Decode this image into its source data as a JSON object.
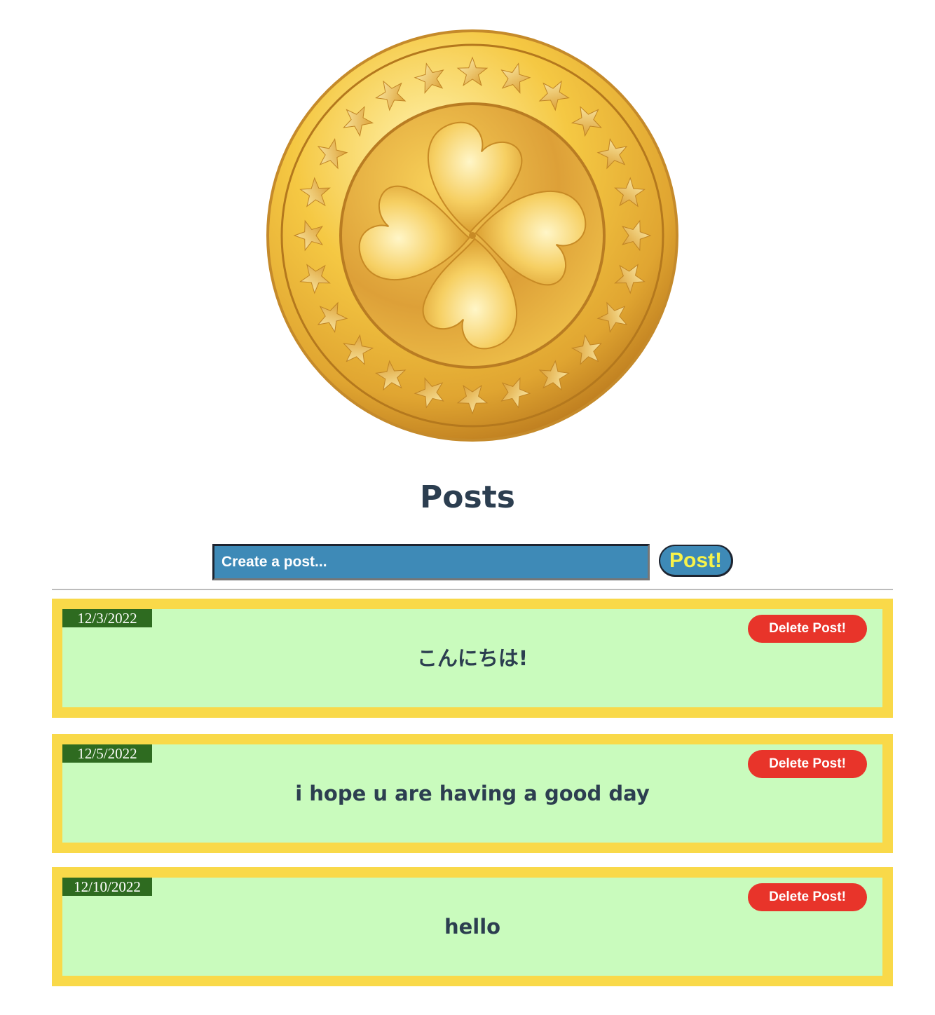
{
  "header": {
    "logo_icon": "gold-clover-coin-icon",
    "title": "Posts"
  },
  "composer": {
    "placeholder": "Create a post...",
    "value": "",
    "post_label": "Post!"
  },
  "posts": [
    {
      "date": "12/3/2022",
      "text": "こんにちは!",
      "delete_label": "Delete Post!"
    },
    {
      "date": "12/5/2022",
      "text": "i hope u are having a good day",
      "delete_label": "Delete Post!"
    },
    {
      "date": "12/10/2022",
      "text": "hello",
      "delete_label": "Delete Post!"
    }
  ],
  "colors": {
    "card_border": "#f9d949",
    "card_background": "#c9fbbd",
    "date_badge": "#2e6b20",
    "delete_button": "#e8342a",
    "input_background": "#3e8ab7",
    "post_button_text": "#f7f24a",
    "text": "#2c3e50"
  }
}
